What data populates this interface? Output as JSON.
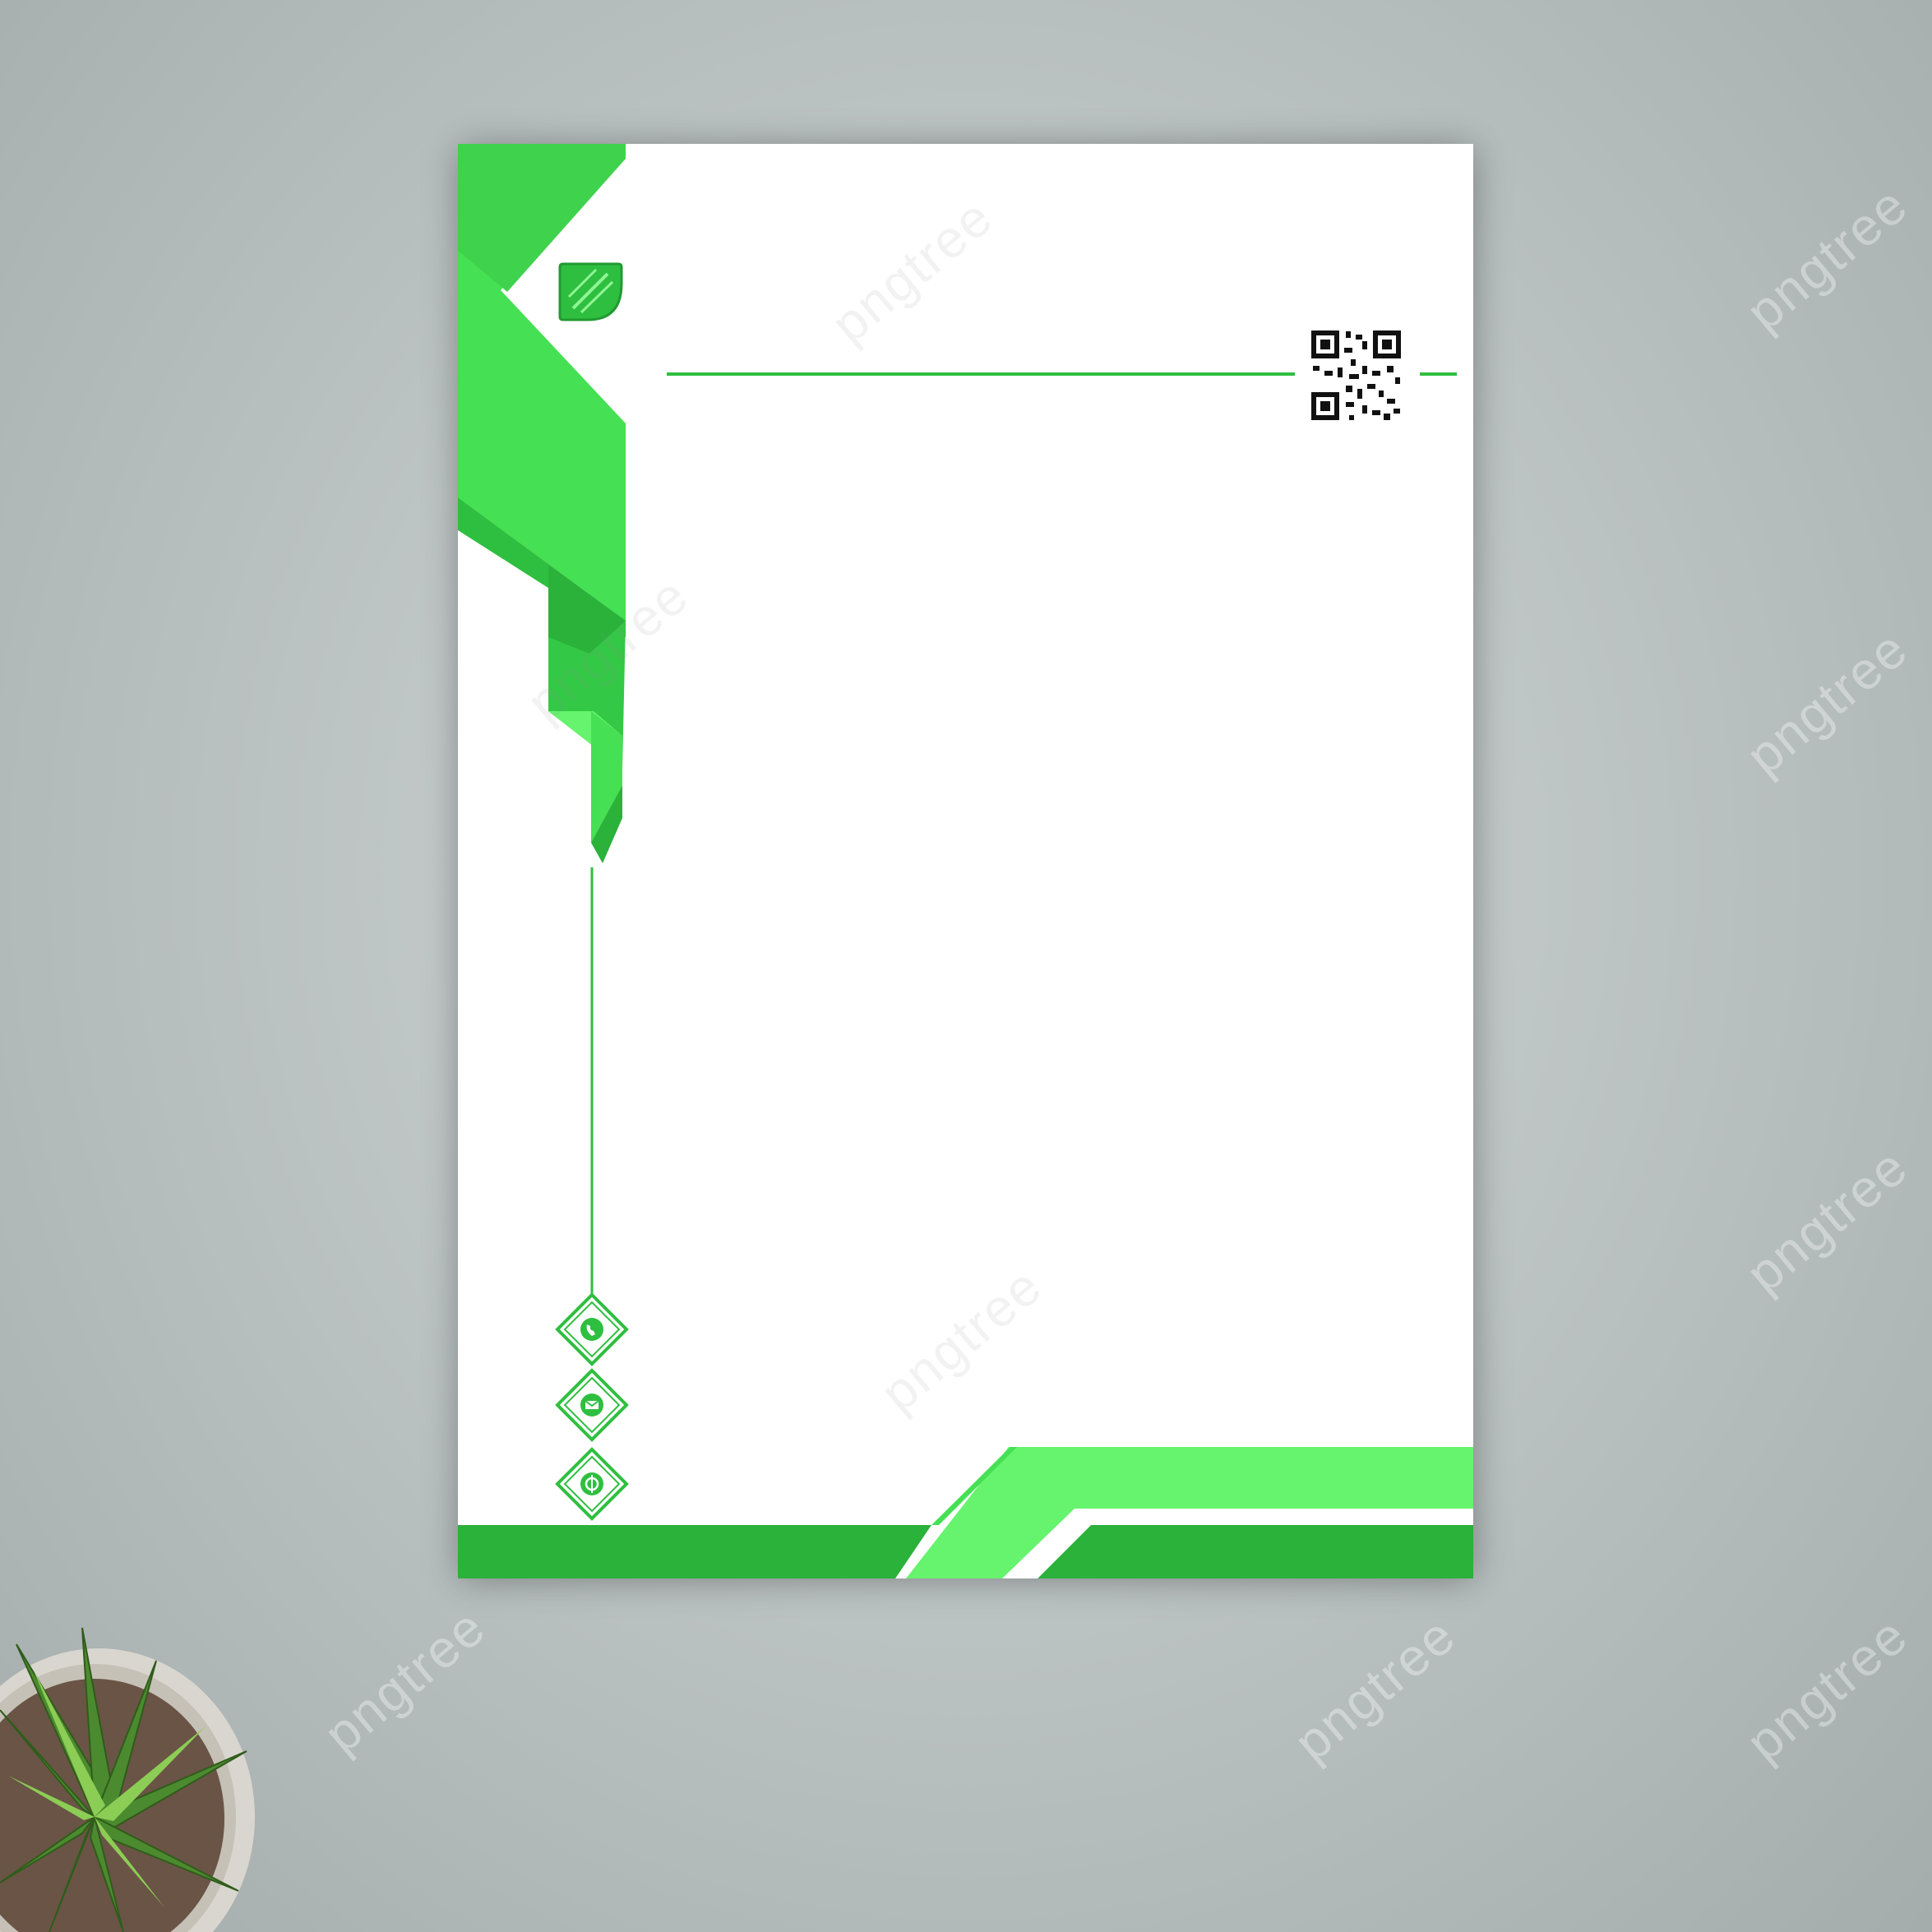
{
  "watermark": {
    "text": "pngtree"
  },
  "letterhead": {
    "accent_green": "#45e053",
    "dark_green": "#2ab23a",
    "light_green": "#66f36d",
    "logo": "leaf-logo-icon",
    "qr": "qr-code-icon",
    "contact_icons": [
      "phone-icon",
      "email-icon",
      "web-icon"
    ]
  }
}
